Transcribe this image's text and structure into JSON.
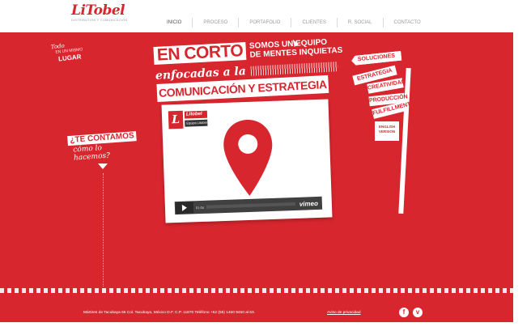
{
  "logo": {
    "word": "LiTobel",
    "tagline": "DISTRIBUTION Y COMUNICACIÓN"
  },
  "nav": {
    "items": [
      {
        "label": "INICIO",
        "active": true
      },
      {
        "label": "PROCESO",
        "active": false
      },
      {
        "label": "PORTAFOLIO",
        "active": false
      },
      {
        "label": "CLIENTES",
        "active": false
      },
      {
        "label": "R. SOCIAL",
        "active": false
      },
      {
        "label": "CONTACTO",
        "active": false
      }
    ]
  },
  "badge": {
    "line1": "Todo",
    "line2": "EN UN MISMO",
    "line3": "LUGAR"
  },
  "headline": {
    "en_corto": "EN CORTO",
    "somos1": "SOMOS UN EQUIPO",
    "somos2": "DE MENTES INQUIETAS",
    "enfocadas": "enfocadas a la",
    "comunicacion": "COMUNICACIÓN Y ESTRATEGIA"
  },
  "te_contamos": {
    "line1": "¿TE CONTAMOS",
    "line2": "cómo lo hacemos?"
  },
  "video": {
    "logo_letter": "L",
    "logo_word": "Litobel",
    "logo_sub": "Equipo Litobel",
    "time": "01:04",
    "provider": "vimeo"
  },
  "signpost": {
    "items": [
      "SOLUCIONES",
      "ESTRATEGIA",
      "CREATIVIDAD",
      "PRODUCCIÓN",
      "FULFILLMENT"
    ],
    "english_line1": "ENGLISH",
    "english_line2": "VERSION"
  },
  "footer": {
    "address": "Mártires de Tacubaya 65 Col. Tacubaya, México D.F. C.P. 11870 Teléfono +52 (55) 1450 9450 al 63.",
    "privacy": "Aviso de privacidad",
    "facebook_icon": "f",
    "vimeo_icon": "v"
  },
  "colors": {
    "brand_red": "#d7262e",
    "white": "#ffffff"
  }
}
